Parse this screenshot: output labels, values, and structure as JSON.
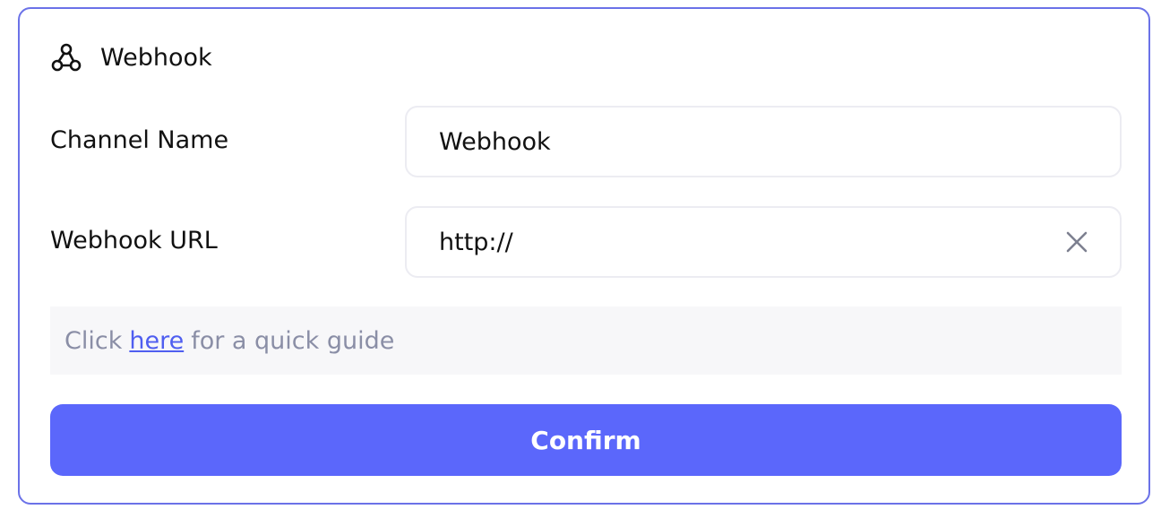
{
  "header": {
    "icon": "webhook-icon",
    "title": "Webhook"
  },
  "form": {
    "channel_name_label": "Channel Name",
    "channel_name_value": "Webhook",
    "webhook_url_label": "Webhook URL",
    "webhook_url_value": "http://"
  },
  "guide": {
    "prefix": "Click",
    "link_text": "here",
    "suffix": "for a quick guide"
  },
  "actions": {
    "confirm_label": "Confirm"
  },
  "colors": {
    "accent": "#5b67fb",
    "border": "#6b72e8",
    "link": "#4f5ef0",
    "muted_text": "#8a8ea6"
  }
}
